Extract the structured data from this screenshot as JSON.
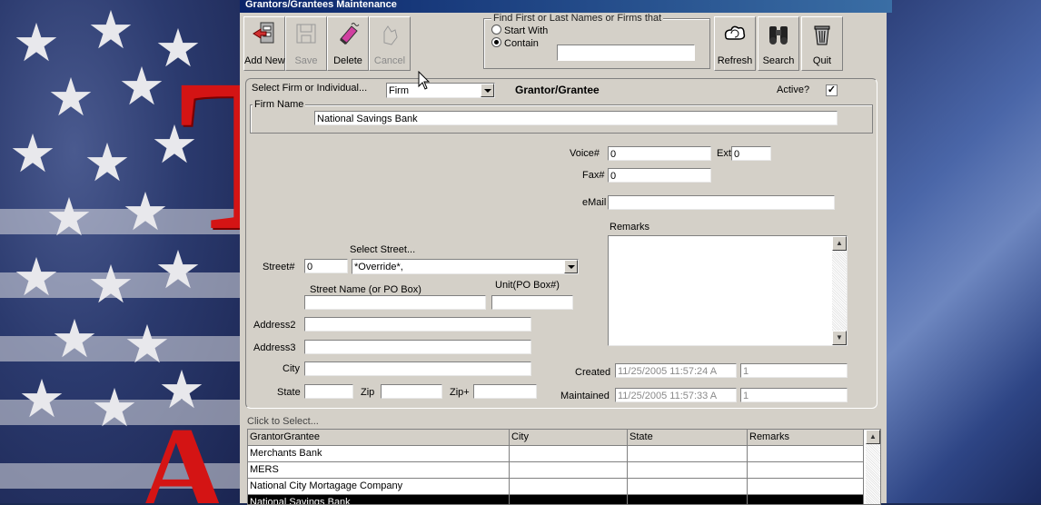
{
  "window": {
    "title": "Grantors/Grantees Maintenance"
  },
  "toolbar": {
    "add_new": "Add New",
    "save": "Save",
    "delete": "Delete",
    "cancel": "Cancel",
    "refresh": "Refresh",
    "search": "Search",
    "quit": "Quit"
  },
  "find": {
    "title": "Find First or Last Names or Firms that",
    "start_with": "Start With",
    "contain": "Contain",
    "selected": "Contain",
    "value": ""
  },
  "form": {
    "select_label": "Select Firm or Individual...",
    "select_value": "Firm",
    "heading": "Grantor/Grantee",
    "active_label": "Active?",
    "active_checked": true,
    "active_mark": "✓",
    "firm_name_label": "Firm Name",
    "firm_name": "National Savings Bank",
    "voice_label": "Voice#",
    "voice": "0",
    "ext_label": "Ext",
    "ext": "0",
    "fax_label": "Fax#",
    "fax": "0",
    "email_label": "eMail",
    "email": "",
    "remarks_label": "Remarks",
    "remarks": "",
    "select_street_label": "Select Street...",
    "street_num_label": "Street#",
    "street_num": "0",
    "street_select": "*Override*,",
    "street_name_label": "Street Name (or PO Box)",
    "street_name": "",
    "unit_label": "Unit(PO Box#)",
    "unit": "",
    "address2_label": "Address2",
    "address2": "",
    "address3_label": "Address3",
    "address3": "",
    "city_label": "City",
    "city": "",
    "state_label": "State",
    "state": "",
    "zip_label": "Zip",
    "zip": "",
    "zipplus_label": "Zip+",
    "zipplus": "",
    "created_label": "Created",
    "created": "11/25/2005 11:57:24 A",
    "created_by": "1",
    "maintained_label": "Maintained",
    "maintained": "11/25/2005 11:57:33 A",
    "maintained_by": "1"
  },
  "grid": {
    "caption": "Click to Select...",
    "columns": [
      "GrantorGrantee",
      "City",
      "State",
      "Remarks"
    ],
    "rows": [
      [
        "Merchants Bank",
        "",
        "",
        ""
      ],
      [
        "MERS",
        "",
        "",
        ""
      ],
      [
        "National City Mortagage Company",
        "",
        "",
        ""
      ],
      [
        "National Savings Bank",
        "",
        "",
        ""
      ]
    ],
    "selected_index": 3
  },
  "background": {
    "letter_top": "T",
    "letter_bottom": "A"
  },
  "colors": {
    "titlebar": "#0a246a",
    "window": "#d4d0c8",
    "accent_red": "#d41414"
  }
}
